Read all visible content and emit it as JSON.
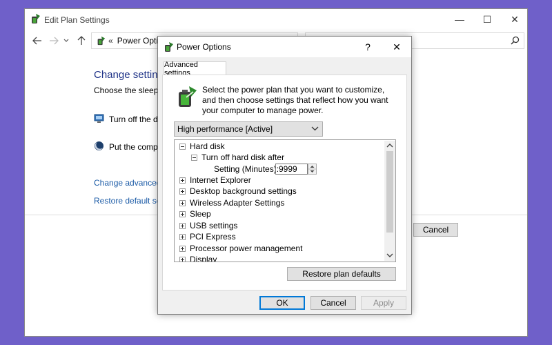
{
  "background_window": {
    "title": "Edit Plan Settings",
    "minimize": "—",
    "maximize": "☐",
    "close": "✕",
    "address_path": "Power Opti",
    "address_chevron": "«",
    "heading": "Change setting",
    "subtext": "Choose the sleep ar",
    "display_setting": "Turn off the dis",
    "sleep_setting": "Put the compu",
    "link_advanced": "Change advanced p",
    "link_restore": "Restore default setti",
    "cancel_label": "Cancel"
  },
  "dialog": {
    "title": "Power Options",
    "help": "?",
    "close": "✕",
    "tab_label": "Advanced settings",
    "description": "Select the power plan that you want to customize, and then choose settings that reflect how you want your computer to manage power.",
    "plan_selected": "High performance [Active]",
    "tree": [
      {
        "label": "Hard disk",
        "expanded": true,
        "level": 0
      },
      {
        "label": "Turn off hard disk after",
        "expanded": true,
        "level": 1
      },
      {
        "label": "Internet Explorer",
        "expanded": false,
        "level": 0
      },
      {
        "label": "Desktop background settings",
        "expanded": false,
        "level": 0
      },
      {
        "label": "Wireless Adapter Settings",
        "expanded": false,
        "level": 0
      },
      {
        "label": "Sleep",
        "expanded": false,
        "level": 0
      },
      {
        "label": "USB settings",
        "expanded": false,
        "level": 0
      },
      {
        "label": "PCI Express",
        "expanded": false,
        "level": 0
      },
      {
        "label": "Processor power management",
        "expanded": false,
        "level": 0
      },
      {
        "label": "Display",
        "expanded": false,
        "level": 0
      }
    ],
    "setting_label": "Setting (Minutes):",
    "setting_value": "9999",
    "restore_button": "Restore plan defaults",
    "ok": "OK",
    "cancel": "Cancel",
    "apply": "Apply"
  },
  "colors": {
    "desktop": "#6f60c9",
    "link": "#1a5aa6",
    "heading": "#1e3287",
    "focus_border": "#0078d7"
  }
}
